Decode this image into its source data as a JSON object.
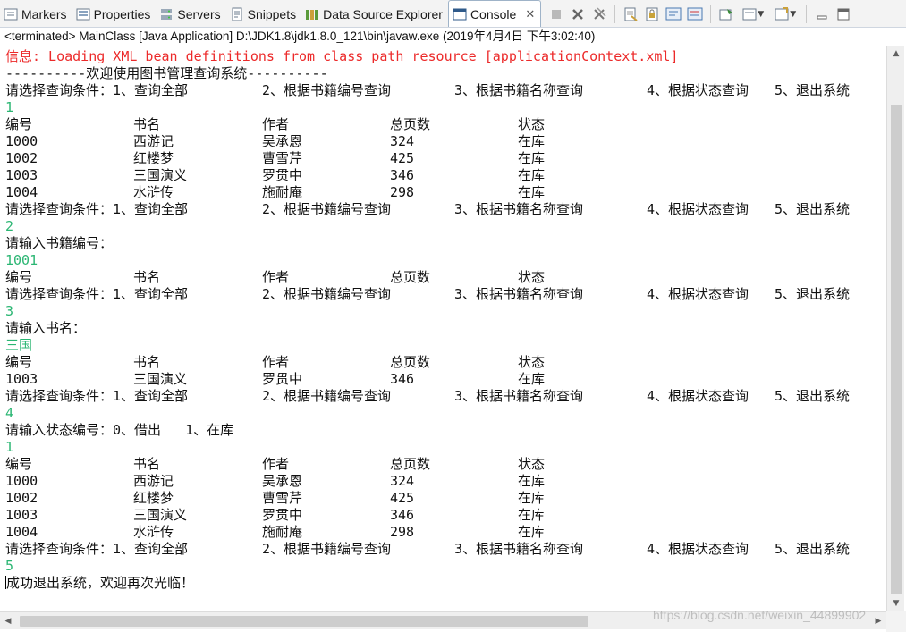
{
  "tabs": [
    {
      "label": "Markers",
      "icon": "markers-icon"
    },
    {
      "label": "Properties",
      "icon": "properties-icon"
    },
    {
      "label": "Servers",
      "icon": "servers-icon"
    },
    {
      "label": "Snippets",
      "icon": "snippets-icon"
    },
    {
      "label": "Data Source Explorer",
      "icon": "data-source-icon"
    },
    {
      "label": "Console",
      "icon": "console-icon",
      "active": true
    }
  ],
  "status_line": "<terminated> MainClass [Java Application] D:\\JDK1.8\\jdk1.8.0_121\\bin\\javaw.exe (2019年4月4日 下午3:02:40)",
  "colors": {
    "error": "#ec2a2a",
    "input": "#2bb673",
    "text": "#111111"
  },
  "console": {
    "log_line": "信息: Loading XML bean definitions from class path resource [applicationContext.xml]",
    "banner": "----------欢迎使用图书管理查询系统----------",
    "menu": [
      "请选择查询条件：1、查询全部",
      "2、根据书籍编号查询",
      "3、根据书籍名称查询",
      "4、根据状态查询",
      "5、退出系统"
    ],
    "header": [
      "编号",
      "书名",
      "作者",
      "总页数",
      "状态"
    ],
    "inputs": [
      "1",
      "2",
      "1001",
      "3",
      "三国",
      "4",
      "1",
      "5"
    ],
    "prompt_id": "请输入书籍编号：",
    "prompt_name": "请输入书名：",
    "prompt_status": "请输入状态编号：0、借出   1、在库",
    "books": [
      [
        "1000",
        "西游记",
        "吴承恩",
        "324",
        "在库"
      ],
      [
        "1002",
        "红楼梦",
        "曹雪芹",
        "425",
        "在库"
      ],
      [
        "1003",
        "三国演义",
        "罗贯中",
        "346",
        "在库"
      ],
      [
        "1004",
        "水浒传",
        "施耐庵",
        "298",
        "在库"
      ]
    ],
    "exit_message": "成功退出系统，欢迎再次光临！"
  },
  "watermark": "https://blog.csdn.net/weixin_44899902"
}
